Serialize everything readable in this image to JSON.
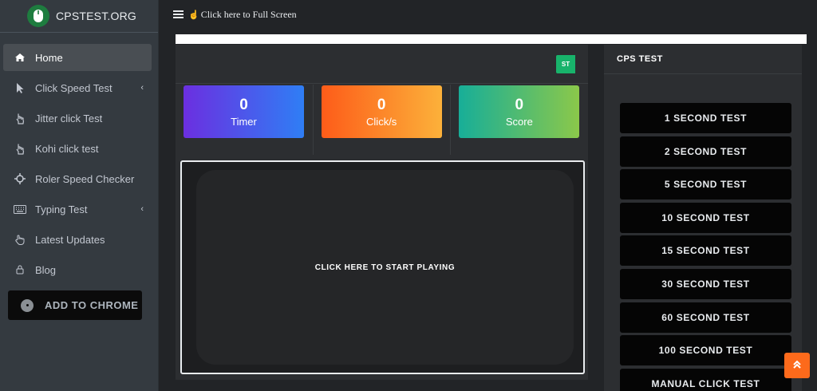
{
  "brand": {
    "name": "CPSTEST.ORG",
    "logo_icon": "mouse-icon"
  },
  "sidebar": {
    "items": [
      {
        "label": "Home",
        "icon": "home-icon",
        "active": true,
        "has_caret": false
      },
      {
        "label": "Click Speed Test",
        "icon": "cursor-icon",
        "active": false,
        "has_caret": true
      },
      {
        "label": "Jitter click Test",
        "icon": "pointer-hand-icon",
        "active": false,
        "has_caret": false
      },
      {
        "label": "Kohi click test",
        "icon": "pointer-hand-icon",
        "active": false,
        "has_caret": false
      },
      {
        "label": "Roler Speed Checker",
        "icon": "crosshair-icon",
        "active": false,
        "has_caret": false
      },
      {
        "label": "Typing Test",
        "icon": "keyboard-icon",
        "active": false,
        "has_caret": true
      },
      {
        "label": "Latest Updates",
        "icon": "hand-icon",
        "active": false,
        "has_caret": false
      },
      {
        "label": "Blog",
        "icon": "lock-icon",
        "active": false,
        "has_caret": false
      }
    ],
    "chrome_button": "ADD TO CHROME"
  },
  "topbar": {
    "fullscreen_label": "Click here to Full Screen"
  },
  "main": {
    "start_button": "ST",
    "stats": [
      {
        "value": "0",
        "label": "Timer"
      },
      {
        "value": "0",
        "label": "Click/s"
      },
      {
        "value": "0",
        "label": "Score"
      }
    ],
    "play_prompt": "CLICK HERE TO START PLAYING"
  },
  "right_panel": {
    "title": "CPS TEST",
    "tests": [
      "1 SECOND TEST",
      "2 SECOND TEST",
      "5 SECOND TEST",
      "10 SECOND TEST",
      "15 SECOND TEST",
      "30 SECOND TEST",
      "60 SECOND TEST",
      "100 SECOND TEST",
      "MANUAL CLICK TEST"
    ]
  },
  "colors": {
    "accent_green": "#18b36b",
    "scroll_top": "#fd6a1b",
    "sidebar_bg": "#343a40"
  }
}
